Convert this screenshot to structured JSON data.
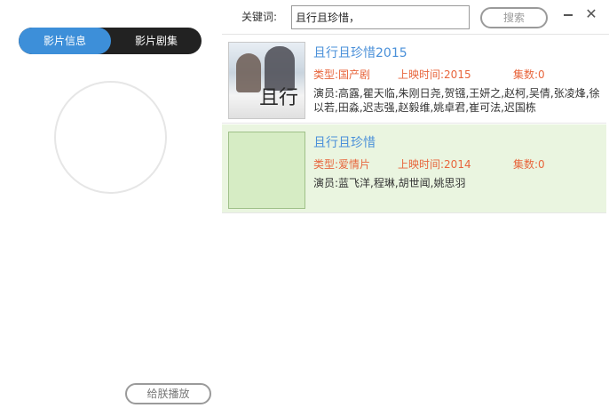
{
  "search": {
    "label": "关键词:",
    "value": "且行且珍惜，",
    "button": "搜索"
  },
  "window": {
    "minimize_icon": "minimize-icon",
    "close_icon": "close-icon",
    "close_glyph": "✕"
  },
  "left": {
    "tabs": [
      {
        "label": "影片信息",
        "active": true
      },
      {
        "label": "影片剧集",
        "active": false
      }
    ],
    "play_button": "给朕播放"
  },
  "results": [
    {
      "title": "且行且珍惜2015",
      "type_label": "类型:",
      "type_value": "国产剧",
      "date_label": "上映时间:",
      "date_value": "2015",
      "episodes_label": "集数:",
      "episodes_value": "0",
      "cast_label": "演员:",
      "cast_value": "高露,瞿天临,朱刚日尧,贺镪,王妍之,赵柯,吴倩,张凌烽,徐以若,田淼,迟志强,赵毅维,姚卓君,崔可法,迟国栋",
      "poster_glyph": "且行"
    },
    {
      "title": "且行且珍惜",
      "type_label": "类型:",
      "type_value": "爱情片",
      "date_label": "上映时间:",
      "date_value": "2014",
      "episodes_label": "集数:",
      "episodes_value": "0",
      "cast_label": "演员:",
      "cast_value": "蓝飞洋,程琳,胡世闻,姚思羽"
    }
  ],
  "colors": {
    "accent": "#3d8fd9",
    "meta": "#e8663d",
    "selected_row": "#eaf5e0"
  }
}
